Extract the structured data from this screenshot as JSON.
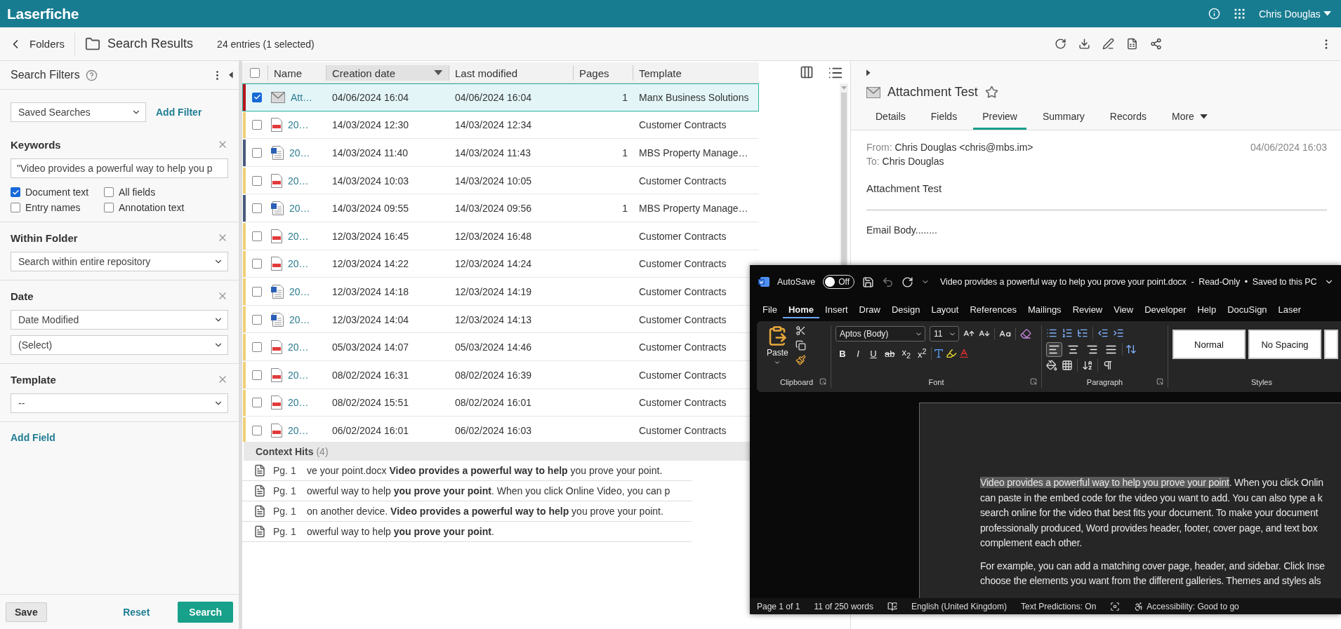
{
  "app": {
    "logo": "Laserfiche",
    "user": "Chris Douglas"
  },
  "toolbar": {
    "back": "Folders",
    "title": "Search Results",
    "count": "24 entries (1 selected)"
  },
  "filters": {
    "title": "Search Filters",
    "saved_searches": "Saved Searches",
    "add_filter": "Add Filter",
    "add_field": "Add Field",
    "save": "Save",
    "reset": "Reset",
    "search": "Search",
    "sections": [
      {
        "kind": "keywords",
        "title": "Keywords",
        "value": "\"Video provides a powerful way to help you p",
        "options": [
          {
            "label": "Document text",
            "checked": true
          },
          {
            "label": "All fields",
            "checked": false
          },
          {
            "label": "Entry names",
            "checked": false
          },
          {
            "label": "Annotation text",
            "checked": false
          }
        ]
      },
      {
        "kind": "selects",
        "title": "Within Folder",
        "selects": [
          "Search within entire repository"
        ]
      },
      {
        "kind": "selects",
        "title": "Date",
        "selects": [
          "Date Modified",
          "(Select)"
        ]
      },
      {
        "kind": "selects",
        "title": "Template",
        "selects": [
          "--"
        ]
      }
    ]
  },
  "table": {
    "all_selected": false,
    "columns": [
      {
        "label": "Name",
        "sorted": false
      },
      {
        "label": "Creation date",
        "sorted": true
      },
      {
        "label": "Last modified",
        "sorted": false
      },
      {
        "label": "Pages",
        "sorted": false
      },
      {
        "label": "Template",
        "sorted": false
      }
    ],
    "rows": [
      {
        "kind": "mail",
        "name": "Att…",
        "created": "04/06/2024 16:04",
        "modified": "04/06/2024 16:04",
        "pages": "1",
        "template": "Manx Business Solutions",
        "color": "#b8141e",
        "selected": true
      },
      {
        "kind": "pdf",
        "name": "20…",
        "created": "14/03/2024 12:30",
        "modified": "14/03/2024 12:34",
        "template": "Customer Contracts",
        "color": "#f0d078",
        "selected": false
      },
      {
        "kind": "word",
        "name": "20…",
        "created": "14/03/2024 11:40",
        "modified": "14/03/2024 11:43",
        "pages": "1",
        "template": "MBS Property Manage…",
        "color": "#4b5a7e",
        "selected": false
      },
      {
        "kind": "pdf",
        "name": "20…",
        "created": "14/03/2024 10:03",
        "modified": "14/03/2024 10:05",
        "template": "Customer Contracts",
        "color": "#f0d078",
        "selected": false
      },
      {
        "kind": "word",
        "name": "20…",
        "created": "14/03/2024 09:55",
        "modified": "14/03/2024 09:56",
        "pages": "1",
        "template": "MBS Property Manage…",
        "color": "#4b5a7e",
        "selected": false
      },
      {
        "kind": "pdf",
        "name": "20…",
        "created": "12/03/2024 16:45",
        "modified": "12/03/2024 16:48",
        "template": "Customer Contracts",
        "color": "#f0d078",
        "selected": false
      },
      {
        "kind": "pdf",
        "name": "20…",
        "created": "12/03/2024 14:22",
        "modified": "12/03/2024 14:24",
        "template": "Customer Contracts",
        "color": "#f0d078",
        "selected": false
      },
      {
        "kind": "word",
        "name": "20…",
        "created": "12/03/2024 14:18",
        "modified": "12/03/2024 14:19",
        "template": "Customer Contracts",
        "color": "#f0d078",
        "selected": false
      },
      {
        "kind": "word",
        "name": "20…",
        "created": "12/03/2024 14:04",
        "modified": "12/03/2024 14:13",
        "template": "Customer Contracts",
        "color": "#f0d078",
        "selected": false
      },
      {
        "kind": "pdf",
        "name": "20…",
        "created": "05/03/2024 14:07",
        "modified": "05/03/2024 14:46",
        "template": "Customer Contracts",
        "color": "#f0d078",
        "selected": false
      },
      {
        "kind": "pdf",
        "name": "20…",
        "created": "08/02/2024 16:31",
        "modified": "08/02/2024 16:39",
        "template": "Customer Contracts",
        "color": "#f0d078",
        "selected": false
      },
      {
        "kind": "pdf",
        "name": "20…",
        "created": "08/02/2024 15:51",
        "modified": "08/02/2024 16:01",
        "template": "Customer Contracts",
        "color": "#f0d078",
        "selected": false
      },
      {
        "kind": "pdf",
        "name": "20…",
        "created": "06/02/2024 16:01",
        "modified": "06/02/2024 16:03",
        "template": "Customer Contracts",
        "color": "#f0d078",
        "selected": false
      }
    ]
  },
  "context_hits": {
    "title": "Context Hits",
    "count": "(4)",
    "items": [
      {
        "page": "Pg. 1",
        "text": "ve your point.docx **Video provides a powerful way to help** you prove your point."
      },
      {
        "page": "Pg. 1",
        "text": "owerful way to help **you prove your point**. When you click Online Video, you can p"
      },
      {
        "page": "Pg. 1",
        "text": "on another device. **Video provides a powerful way to help** you prove your point."
      },
      {
        "page": "Pg. 1",
        "text": "owerful way to help **you prove your point**."
      }
    ]
  },
  "preview": {
    "title": "Attachment Test",
    "tabs": [
      {
        "label": "Details",
        "selected": false
      },
      {
        "label": "Fields",
        "selected": false
      },
      {
        "label": "Preview",
        "selected": true
      },
      {
        "label": "Summary",
        "selected": false
      },
      {
        "label": "Records",
        "selected": false
      },
      {
        "label": "More",
        "selected": false
      }
    ],
    "from_label": "From:",
    "from": "Chris Douglas <chris@mbs.im>",
    "date": "04/06/2024 16:03",
    "to_label": "To:",
    "to": "Chris Douglas",
    "subject": "Attachment Test",
    "body": "Email Body........"
  },
  "word": {
    "autosave": "AutoSave",
    "autosave_on": false,
    "autosave_state": "Off",
    "title": "Video provides a powerful way to help you prove your point.docx  -  Read-Only  •  Saved to this PC",
    "tabs": [
      {
        "label": "File",
        "selected": false
      },
      {
        "label": "Home",
        "selected": true
      },
      {
        "label": "Insert",
        "selected": false
      },
      {
        "label": "Draw",
        "selected": false
      },
      {
        "label": "Design",
        "selected": false
      },
      {
        "label": "Layout",
        "selected": false
      },
      {
        "label": "References",
        "selected": false
      },
      {
        "label": "Mailings",
        "selected": false
      },
      {
        "label": "Review",
        "selected": false
      },
      {
        "label": "View",
        "selected": false
      },
      {
        "label": "Developer",
        "selected": false
      },
      {
        "label": "Help",
        "selected": false
      },
      {
        "label": "DocuSign",
        "selected": false
      },
      {
        "label": "Laser",
        "selected": false
      }
    ],
    "paste": "Paste",
    "font": "Aptos (Body)",
    "size": "11",
    "format_buttons": [
      "B",
      "I",
      "U",
      "ab",
      "x$_{2}$",
      "x$^{2}$"
    ],
    "align": [
      {
        "kind": "left",
        "selected": true
      },
      {
        "kind": "center",
        "selected": false
      },
      {
        "kind": "right",
        "selected": false
      },
      {
        "kind": "justify",
        "selected": false
      }
    ],
    "groups": [
      "Clipboard",
      "Font",
      "Paragraph",
      "Styles"
    ],
    "styles": [
      "Normal",
      "No Spacing"
    ],
    "paragraphs": [
      {
        "highlight": "Video provides a powerful way to help you prove your point",
        "lines": [
          ". When you click Onlin",
          "can paste in the embed code for the video you want to add. You can also type a k",
          "search online for the video that best fits your document. To make your document",
          "professionally produced, Word provides header, footer, cover page, and text box",
          "complement each other."
        ]
      },
      {
        "lines": [
          "For example, you can add a matching cover page, header, and sidebar. Click Inse",
          "choose the elements you want from the different galleries. Themes and styles als"
        ]
      }
    ],
    "status": {
      "page": "Page 1 of 1",
      "words": "11 of 250 words",
      "language": "English (United Kingdom)",
      "predictions": "Text Predictions: On",
      "accessibility": "Accessibility: Good to go"
    }
  }
}
